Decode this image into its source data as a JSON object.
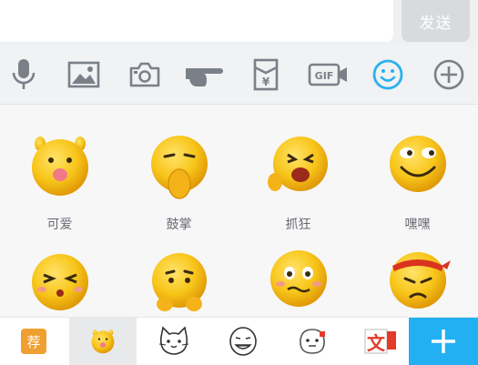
{
  "composer": {
    "send_label": "发送"
  },
  "toolbar": {
    "items": [
      {
        "name": "voice",
        "icon": "microphone-icon"
      },
      {
        "name": "image",
        "icon": "image-icon"
      },
      {
        "name": "camera",
        "icon": "camera-icon"
      },
      {
        "name": "poke",
        "icon": "pointing-hand-icon"
      },
      {
        "name": "red-packet",
        "icon": "red-packet-icon"
      },
      {
        "name": "gif",
        "icon": "gif-icon",
        "text": "GIF"
      },
      {
        "name": "emoji",
        "icon": "smiley-icon",
        "active": true
      },
      {
        "name": "more",
        "icon": "plus-circle-icon"
      }
    ],
    "active_color": "#2ab0ef",
    "icon_color": "#7b8088"
  },
  "emojis": {
    "items": [
      {
        "label": "可爱"
      },
      {
        "label": "鼓掌"
      },
      {
        "label": "抓狂"
      },
      {
        "label": "嘿嘿"
      },
      {
        "label": ""
      },
      {
        "label": ""
      },
      {
        "label": ""
      },
      {
        "label": ""
      }
    ]
  },
  "bottom_bar": {
    "recommend_label": "荐",
    "tabs": [
      {
        "name": "recommend",
        "icon": "recommend-icon"
      },
      {
        "name": "yellow-face-pack",
        "icon": "yellow-face-icon",
        "active": true
      },
      {
        "name": "cat-pack",
        "icon": "cat-icon"
      },
      {
        "name": "rage-face-pack",
        "icon": "rage-face-icon"
      },
      {
        "name": "sticker-pack",
        "icon": "sticker-icon"
      },
      {
        "name": "text-pack",
        "icon": "text-sticker-icon",
        "text": "文"
      }
    ],
    "add_icon": "plus-icon",
    "add_color": "#22b0f2"
  }
}
